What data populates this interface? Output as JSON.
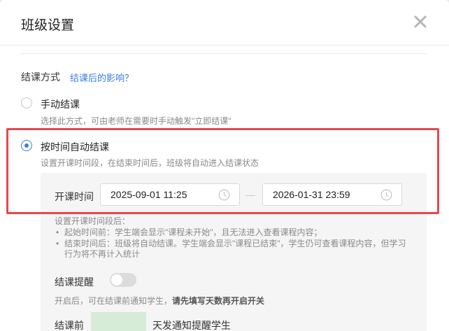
{
  "dialog": {
    "title": "班级设置",
    "close_icon": "close-icon"
  },
  "end_mode": {
    "title": "结课方式",
    "link": "结课后的影响？",
    "options": [
      {
        "label": "手动结课",
        "desc": "选择此方式，可由老师在需要时手动触发\"立即结课\"",
        "checked": false
      },
      {
        "label": "按时间自动结课",
        "desc": "设置开课时间段，在结束时间后，班级将自动进入结课状态",
        "checked": true
      }
    ]
  },
  "schedule": {
    "label": "开课时间",
    "start": "2025-09-01 11:25",
    "end": "2026-01-31 23:59",
    "clock_icon": "clock-icon"
  },
  "notes": {
    "heading": "设置开课时间段后：",
    "item1": "起始时间前：学生端会显示\"课程未开始\"，且无法进入查看课程内容；",
    "item2_line1": "结束时间后：班级将自动结课。学生端会显示\"课程已结束\"，学生仍可查看课程内容，但学习",
    "item2_line2": "行为将不再计入统计"
  },
  "reminder": {
    "label": "结课提醒",
    "enabled": false,
    "desc_prefix": "开启后，可在结课前通知学生，",
    "desc_bold": "请先填写天数再开启开关",
    "before_label": "结课前",
    "days_value": "",
    "after_text": "天发通知提醒学生"
  },
  "colors": {
    "accent": "#3a7fe0",
    "highlight": "#e5484d",
    "panel": "#f5f5f5"
  }
}
